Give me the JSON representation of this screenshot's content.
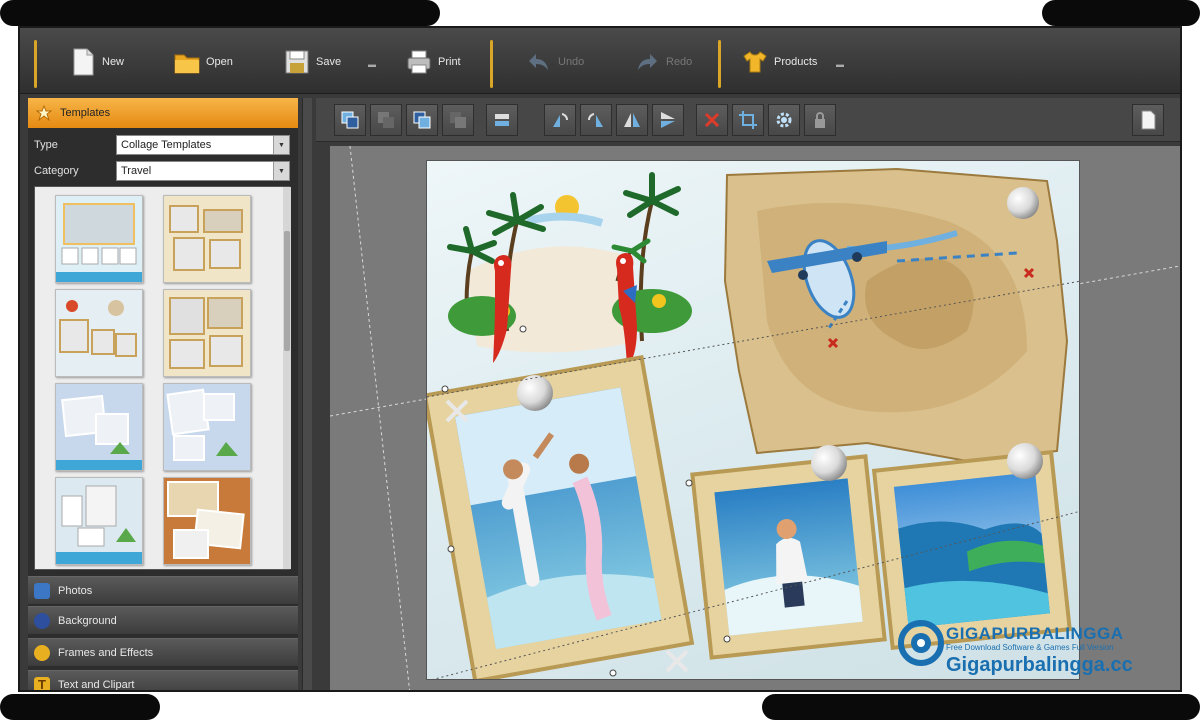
{
  "toolbar": {
    "new_label": "New",
    "open_label": "Open",
    "save_label": "Save",
    "print_label": "Print",
    "undo_label": "Undo",
    "redo_label": "Redo",
    "products_label": "Products"
  },
  "panel": {
    "header": "Templates",
    "type_label": "Type",
    "type_value": "Collage Templates",
    "category_label": "Category",
    "category_value": "Travel"
  },
  "accordion": {
    "photos": "Photos",
    "background": "Background",
    "frames": "Frames and Effects",
    "text": "Text and Clipart"
  },
  "watermark": {
    "brand": "GIGAPURBALINGGA",
    "tagline": "Free Download Software & Games Full Version",
    "url": "Gigapurbalingga.cc"
  },
  "colors": {
    "accent": "#e58a12",
    "separator": "#d9a628",
    "watermark_blue": "#1a6fb0"
  }
}
